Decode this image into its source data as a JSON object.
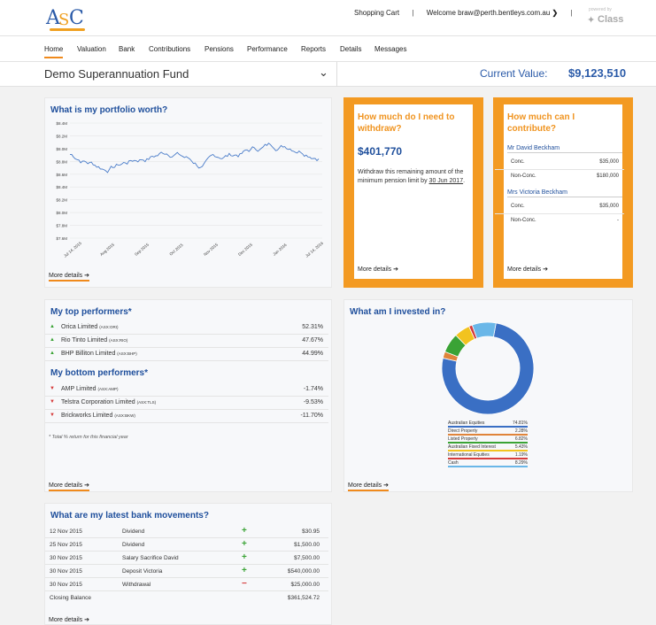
{
  "header": {
    "logo_text": [
      "A",
      "S",
      "C"
    ],
    "shopping_cart": "Shopping Cart",
    "welcome": "Welcome braw@perth.bentleys.com.au",
    "powered_by": "powered by",
    "class_logo": "Class"
  },
  "nav": [
    "Home",
    "Valuation",
    "Bank",
    "Contributions",
    "Pensions",
    "Performance",
    "Reports",
    "Details",
    "Messages"
  ],
  "fund": {
    "name": "Demo Superannuation Fund",
    "current_value_label": "Current Value:",
    "current_value": "$9,123,510"
  },
  "more_details": "More details",
  "portfolio": {
    "title": "What is my portfolio worth?",
    "y_ticks": [
      "$8.4M",
      "$8.2M",
      "$8.0M",
      "$8.8M",
      "$8.6M",
      "$8.4M",
      "$8.2M",
      "$8.0M",
      "$7.8M",
      "$7.6M"
    ],
    "x_ticks": [
      "Jul 14, 2015",
      "Aug 2015",
      "Sep 2015",
      "Oct 2015",
      "Nov 2015",
      "Dec 2015",
      "Jan 2016",
      "Jul 14, 2016"
    ]
  },
  "withdraw": {
    "title": "How much do I need to withdraw?",
    "amount": "$401,770",
    "text": "Withdraw this remaining amount of the minimum pension limit by",
    "date": "30 Jun 2017"
  },
  "contribute": {
    "title": "How much can I contribute?",
    "members": [
      {
        "name": "Mr David Beckham",
        "rows": [
          {
            "label": "Conc.",
            "value": "$35,000"
          },
          {
            "label": "Non-Conc.",
            "value": "$180,000"
          }
        ]
      },
      {
        "name": "Mrs Victoria Beckham",
        "rows": [
          {
            "label": "Conc.",
            "value": "$35,000"
          },
          {
            "label": "Non-Conc.",
            "value": "-"
          }
        ]
      }
    ]
  },
  "performers": {
    "top_title": "My top performers*",
    "top": [
      {
        "name": "Orica Limited",
        "code": "(ASX:ORI)",
        "pct": "52.31%"
      },
      {
        "name": "Rio Tinto Limited",
        "code": "(ASX:RIO)",
        "pct": "47.67%"
      },
      {
        "name": "BHP Billiton Limited",
        "code": "(ASX:BHP)",
        "pct": "44.99%"
      }
    ],
    "bottom_title": "My bottom performers*",
    "bottom": [
      {
        "name": "AMP Limited",
        "code": "(ASX:AMP)",
        "pct": "-1.74%"
      },
      {
        "name": "Telstra Corporation Limited",
        "code": "(ASX:TLS)",
        "pct": "-9.53%"
      },
      {
        "name": "Brickworks Limited",
        "code": "(ASX:BKW)",
        "pct": "-11.70%"
      }
    ],
    "footnote": "* Total % return for this financial year"
  },
  "invested": {
    "title": "What am I invested in?",
    "legend": [
      {
        "name": "Australian Equities",
        "value": "74.81%",
        "color": "#3a6fc4"
      },
      {
        "name": "Direct Property",
        "value": "2.28%",
        "color": "#e0843a"
      },
      {
        "name": "Listed Property",
        "value": "6.82%",
        "color": "#3aa335"
      },
      {
        "name": "Australian Fixed Interest",
        "value": "5.43%",
        "color": "#f2c31f"
      },
      {
        "name": "International Equities",
        "value": "1.19%",
        "color": "#d63c3c"
      },
      {
        "name": "Cash",
        "value": "8.29%",
        "color": "#6ab7e8"
      }
    ]
  },
  "bank": {
    "title": "What are my latest bank movements?",
    "rows": [
      {
        "date": "12 Nov 2015",
        "desc": "Dividend",
        "sign": "+",
        "amount": "$30.95"
      },
      {
        "date": "25 Nov 2015",
        "desc": "Dividend",
        "sign": "+",
        "amount": "$1,500.00"
      },
      {
        "date": "30 Nov 2015",
        "desc": "Salary Sacrifice David",
        "sign": "+",
        "amount": "$7,500.00"
      },
      {
        "date": "30 Nov 2015",
        "desc": "Deposit Victoria",
        "sign": "+",
        "amount": "$540,000.00"
      },
      {
        "date": "30 Nov 2015",
        "desc": "Withdrawal",
        "sign": "−",
        "amount": "$25,000.00"
      }
    ],
    "closing_label": "Closing Balance",
    "closing_value": "$361,524.72"
  }
}
